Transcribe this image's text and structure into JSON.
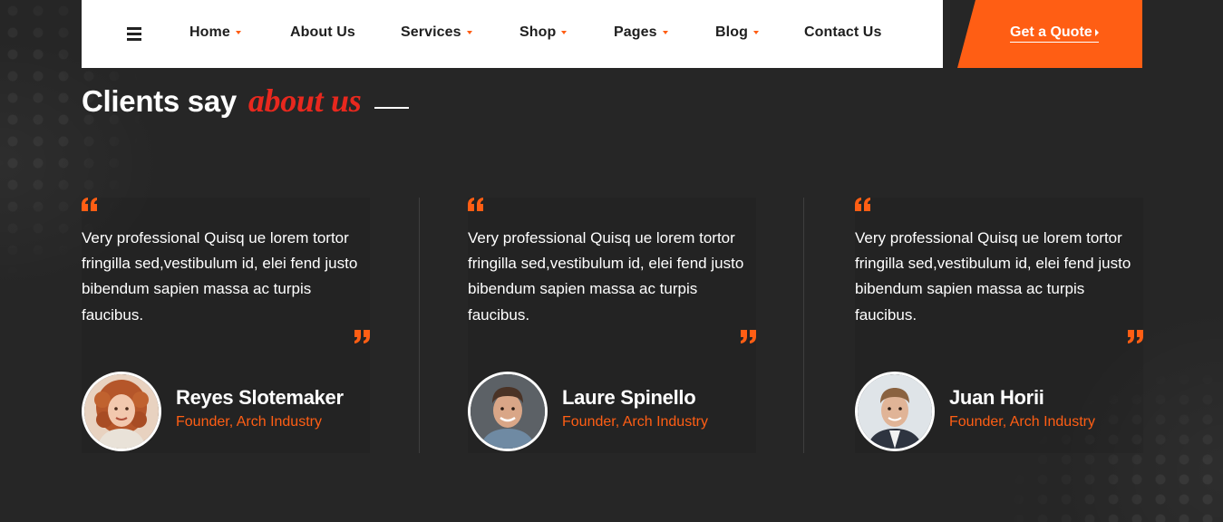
{
  "nav": {
    "items": [
      {
        "label": "Home",
        "dropdown": true
      },
      {
        "label": "About Us",
        "dropdown": false
      },
      {
        "label": "Services",
        "dropdown": true
      },
      {
        "label": "Shop",
        "dropdown": true
      },
      {
        "label": "Pages",
        "dropdown": true
      },
      {
        "label": "Blog",
        "dropdown": true
      },
      {
        "label": "Contact Us",
        "dropdown": false
      }
    ],
    "cta_label": "Get a Quote"
  },
  "section": {
    "title_main": "Clients say",
    "title_accent": "about us"
  },
  "testimonials": [
    {
      "text": "Very professional Quisq ue lorem tortor fringilla sed,vestibulum id, elei fend justo bibendum sapien massa ac turpis faucibus.",
      "name": "Reyes Slotemaker",
      "role": "Founder, Arch Industry"
    },
    {
      "text": "Very professional Quisq ue lorem tortor fringilla sed,vestibulum id, elei fend justo bibendum sapien massa ac turpis faucibus.",
      "name": "Laure Spinello",
      "role": "Founder, Arch Industry"
    },
    {
      "text": "Very professional Quisq ue lorem tortor fringilla sed,vestibulum id, elei fend justo bibendum sapien massa ac turpis faucibus.",
      "name": "Juan Horii",
      "role": "Founder, Arch Industry"
    }
  ],
  "colors": {
    "accent": "#ff5e14",
    "title_accent": "#e8281e",
    "background": "#262626",
    "navbar": "#ffffff"
  }
}
